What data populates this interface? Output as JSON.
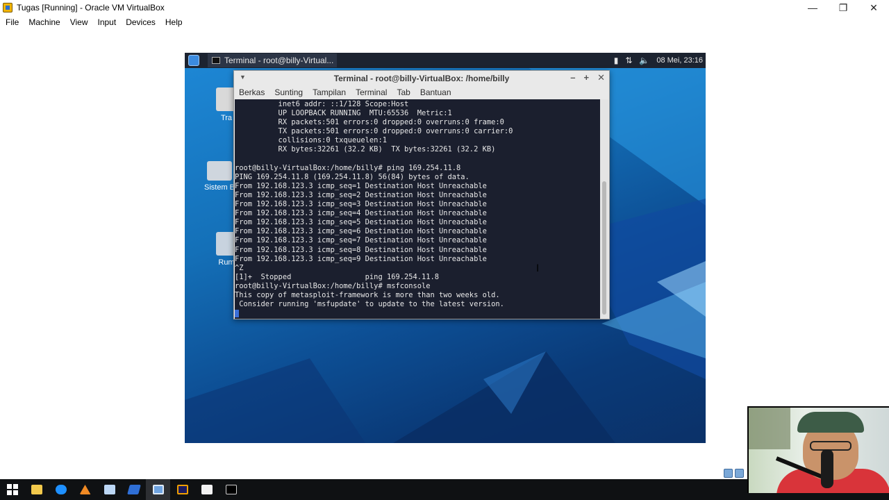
{
  "host": {
    "window_title": "Tugas [Running] - Oracle VM VirtualBox",
    "controls": {
      "minimize": "—",
      "restore": "❐",
      "close": "✕"
    },
    "menus": [
      "File",
      "Machine",
      "View",
      "Input",
      "Devices",
      "Help"
    ]
  },
  "guest": {
    "panel": {
      "task_label": "Terminal - root@billy-Virtual...",
      "clock": "08 Mei, 23:16"
    },
    "desktop_icons": [
      {
        "label": "Tra"
      },
      {
        "label": "Sistem B"
      },
      {
        "label": "Rum"
      }
    ],
    "terminal": {
      "title": "Terminal - root@billy-VirtualBox: /home/billy",
      "menus": [
        "Berkas",
        "Sunting",
        "Tampilan",
        "Terminal",
        "Tab",
        "Bantuan"
      ],
      "lines": [
        "          inet6 addr: ::1/128 Scope:Host",
        "          UP LOOPBACK RUNNING  MTU:65536  Metric:1",
        "          RX packets:501 errors:0 dropped:0 overruns:0 frame:0",
        "          TX packets:501 errors:0 dropped:0 overruns:0 carrier:0",
        "          collisions:0 txqueuelen:1",
        "          RX bytes:32261 (32.2 KB)  TX bytes:32261 (32.2 KB)",
        "",
        "root@billy-VirtualBox:/home/billy# ping 169.254.11.8",
        "PING 169.254.11.8 (169.254.11.8) 56(84) bytes of data.",
        "From 192.168.123.3 icmp_seq=1 Destination Host Unreachable",
        "From 192.168.123.3 icmp_seq=2 Destination Host Unreachable",
        "From 192.168.123.3 icmp_seq=3 Destination Host Unreachable",
        "From 192.168.123.3 icmp_seq=4 Destination Host Unreachable",
        "From 192.168.123.3 icmp_seq=5 Destination Host Unreachable",
        "From 192.168.123.3 icmp_seq=6 Destination Host Unreachable",
        "From 192.168.123.3 icmp_seq=7 Destination Host Unreachable",
        "From 192.168.123.3 icmp_seq=8 Destination Host Unreachable",
        "From 192.168.123.3 icmp_seq=9 Destination Host Unreachable",
        "^Z",
        "[1]+  Stopped                 ping 169.254.11.8",
        "root@billy-VirtualBox:/home/billy# msfconsole",
        "This copy of metasploit-framework is more than two weeks old.",
        " Consider running 'msfupdate' to update to the latest version."
      ]
    }
  },
  "colors": {
    "terminal_bg": "#1b1f2e",
    "terminal_fg": "#e8e8e8",
    "cursor": "#3b6fd8",
    "guest_panel": "#1c2330"
  },
  "taskbar_icons": [
    "windows-start-icon",
    "file-explorer-icon",
    "browser-icon",
    "vlc-icon",
    "notepad-icon",
    "app-icon",
    "virtualbox-icon",
    "media-icon",
    "code-icon",
    "cmd-icon"
  ]
}
